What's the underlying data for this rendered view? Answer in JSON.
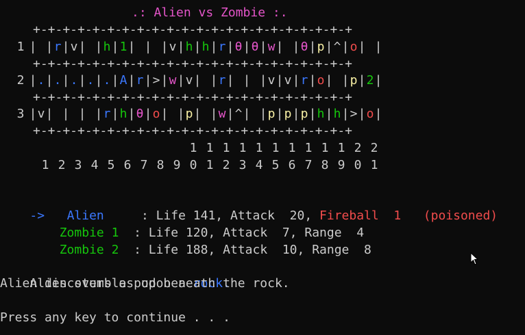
{
  "title": ".: Alien vs Zombie :.",
  "border_row": "+-+-+-+-+-+-+-+-+-+-+-+-+-+-+-+-+-+-+-+-+-+",
  "rows": [
    {
      "label": "1",
      "cells": [
        " ",
        "r",
        "v",
        " ",
        "h",
        "1",
        " ",
        " ",
        "v",
        "h",
        "h",
        "r",
        "θ",
        "θ",
        "w",
        " ",
        "θ",
        "p",
        "^",
        "o",
        " "
      ]
    },
    {
      "label": "2",
      "cells": [
        ".",
        ".",
        ".",
        ".",
        ".",
        "A",
        "r",
        ">",
        "w",
        "v",
        " ",
        "r",
        " ",
        " ",
        "v",
        "v",
        "r",
        "o",
        " ",
        "p",
        "2"
      ]
    },
    {
      "label": "3",
      "cells": [
        "v",
        " ",
        " ",
        " ",
        "r",
        "h",
        "θ",
        "o",
        " ",
        "p",
        " ",
        "w",
        "^",
        " ",
        "p",
        "p",
        "p",
        "h",
        "h",
        ">",
        "o"
      ]
    }
  ],
  "col_tens": [
    " ",
    " ",
    " ",
    " ",
    " ",
    " ",
    " ",
    " ",
    " ",
    "1",
    "1",
    "1",
    "1",
    "1",
    "1",
    "1",
    "1",
    "1",
    "1",
    "2",
    "2"
  ],
  "col_ones": [
    "1",
    "2",
    "3",
    "4",
    "5",
    "6",
    "7",
    "8",
    "9",
    "0",
    "1",
    "2",
    "3",
    "4",
    "5",
    "6",
    "7",
    "8",
    "9",
    "0",
    "1"
  ],
  "cell_colors": {
    "r": "#3b78ff",
    ".": "#3b78ff",
    "A": "#3b78ff",
    "h": "#16c60c",
    "1": "#16c60c",
    "2": "#16c60c",
    "θ": "#e455c9",
    "w": "#e455c9",
    "o": "#f14c4c",
    "p": "#f9f1a5",
    "v": "#cccccc",
    "^": "#cccccc",
    ">": "#cccccc",
    " ": "#cccccc"
  },
  "status": {
    "arrow": "->",
    "alien": {
      "name": "Alien",
      "stats": ": Life 141, Attack  20, ",
      "item": "Fireball  1",
      "effect": "(poisoned)"
    },
    "zombies": [
      {
        "name": "Zombie 1",
        "stats": ": Life 120, Attack  7, Range  4"
      },
      {
        "name": "Zombie 2",
        "stats": ": Life 188, Attack  10, Range  8"
      }
    ]
  },
  "messages": {
    "line1_prefix": "Alien stumbles upon a ",
    "line1_object": "rock.",
    "line2": "Alien discovers a pod beneath the rock.",
    "prompt": "Press any key to continue . . ."
  },
  "colors": {
    "background": "#0c0c0c",
    "text": "#cccccc",
    "title": "#e455c9",
    "alien": "#3b78ff",
    "zombie": "#16c60c",
    "alert": "#f14c4c",
    "highlight": "#3b78ff"
  },
  "cursor_icon": "mouse-pointer-icon"
}
